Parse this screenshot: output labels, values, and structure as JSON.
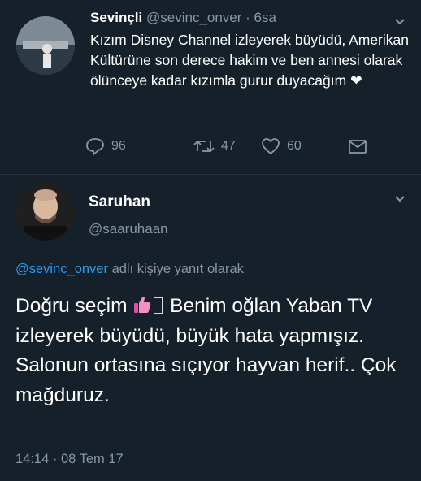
{
  "tweet1": {
    "display_name": "Sevinçli",
    "handle": "@sevinc_onver",
    "separator": " · ",
    "age": "6sa",
    "text": "Kızım Disney Channel izleyerek büyüdü, Amerikan Kültürüne son derece hakim ve ben annesi olarak ölünceye kadar kızımla gurur duyacağım",
    "heart_emoji": "❤",
    "replies": "96",
    "retweets": "47",
    "likes": "60"
  },
  "tweet2": {
    "display_name": "Saruhan",
    "handle": "@saaruhaan",
    "reply_to_handle": "@sevinc_onver",
    "reply_to_suffix": " adlı kişiye yanıt olarak",
    "text_start": "Doğru seçim",
    "text_rest": " Benim oğlan Yaban TV izleyerek büyüdü, büyük hata yapmışız. Salonun ortasına sıçıyor hayvan herif.. Çok mağduruz.",
    "time": "14:14",
    "date": "08 Tem 17"
  },
  "colors": {
    "background": "#15202b",
    "muted": "#8899a6",
    "link": "#1da1f2",
    "divider": "#253341"
  },
  "icons": [
    "reply-icon",
    "retweet-icon",
    "like-icon",
    "dm-icon",
    "chevron-down-icon",
    "thumbs-up-emoji"
  ]
}
